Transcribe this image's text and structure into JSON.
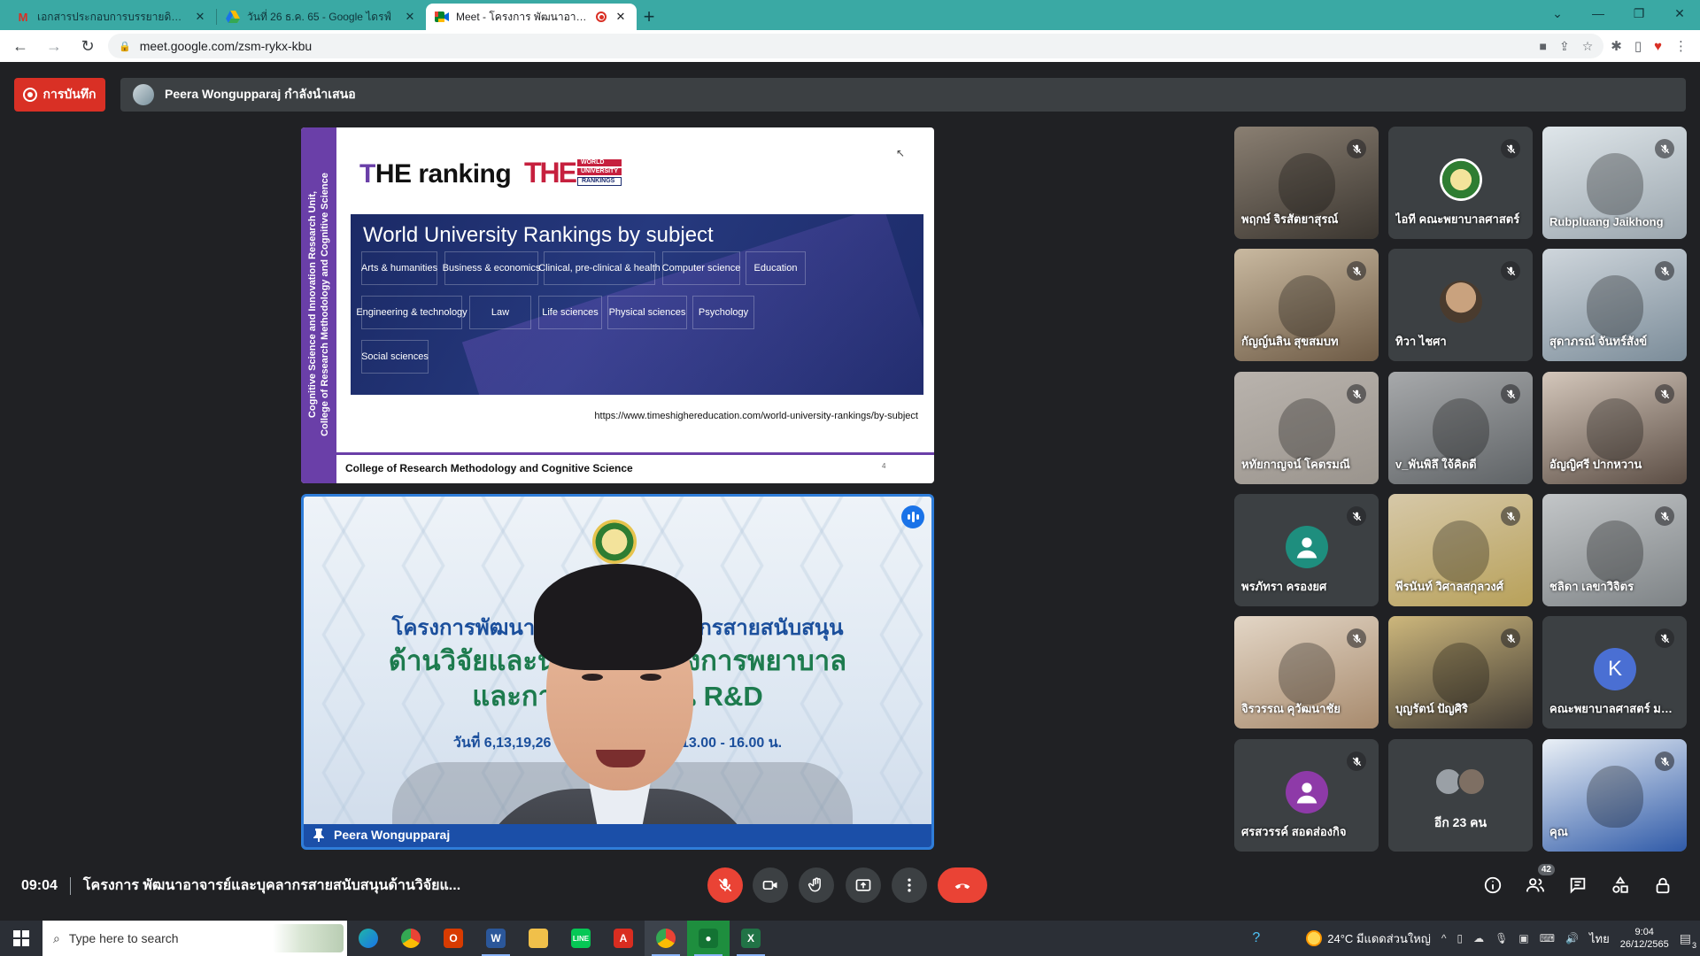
{
  "browser": {
    "tabs": [
      {
        "title": "เอกสารประกอบการบรรยายดิจิทัลพิมพ์นำเสนอ",
        "favicon": "gmail-icon",
        "active": false
      },
      {
        "title": "วันที่ 26 ธ.ค. 65 - Google ไดรฟ์",
        "favicon": "google-drive-icon",
        "active": false
      },
      {
        "title": "Meet - โครงการ พัฒนาอาจารย์และบุคลากร",
        "favicon": "google-meet-icon",
        "active": true
      }
    ],
    "new_tab": "+",
    "url": "meet.google.com/zsm-rykx-kbu"
  },
  "meet": {
    "recording_label": "การบันทึก",
    "presenting_text": "Peera Wongupparaj กำลังนำเสนอ",
    "slide": {
      "side_text_line1": "Cognitive Science and Innovation Research Unit,",
      "side_text_line2": "College of Research Methodology and Cognitive Science",
      "title_first": "T",
      "title_rest": "HE ranking",
      "logo_mark": "THE",
      "logo_line1": "WORLD",
      "logo_line2": "UNIVERSITY",
      "logo_line3": "RANKINGS",
      "panel_title": "World University Rankings by subject",
      "subjects": [
        "Arts & humanities",
        "Business & economics",
        "Clinical, pre-clinical & health",
        "Computer science",
        "Education",
        "Engineering & technology",
        "Law",
        "Life sciences",
        "Physical sciences",
        "Psychology",
        "Social sciences"
      ],
      "url": "https://www.timeshighereducation.com/world-university-rankings/by-subject",
      "footer": "College of Research Methodology and Cognitive Science",
      "page_number": "4"
    },
    "presenter": {
      "name": "Peera Wongupparaj",
      "banner_line1": "โครงการพัฒนาอาจารย์และบุคลากรสายสนับสนุน",
      "banner_line2": "ด้านวิจัยและนวัตกรรมทางการพยาบาล",
      "banner_line3": "และการดำเนินงาน R&D",
      "banner_line4": "แบบ",
      "banner_line5": "วันที่ 6,13,19,26 ธันวาคม 2565 เวลา 13.00 - 16.00 น.",
      "banner_line6": "CNEU"
    },
    "participants": [
      {
        "name": "พฤกษ์ จิรสัตยาสุรณ์",
        "kind": "photo",
        "colors": [
          "#8a7f72",
          "#3b3630"
        ]
      },
      {
        "name": "ไอที คณะพยาบาลศาสตร์",
        "kind": "logo",
        "colors": [
          "#3c4043",
          "#2e7d32"
        ]
      },
      {
        "name": "Rubpluang Jaikhong",
        "kind": "photo",
        "colors": [
          "#dfe6ea",
          "#9aa5ad"
        ]
      },
      {
        "name": "กัญญ์นลิน สุขสมบท",
        "kind": "photo",
        "colors": [
          "#c9b9a0",
          "#6d5a45"
        ]
      },
      {
        "name": "ทิวา ไชศา",
        "kind": "photo-avatar",
        "colors": [
          "#3c4043",
          "#c9a27e"
        ]
      },
      {
        "name": "สุดาภรณ์ จันทร์สังข์",
        "kind": "photo",
        "colors": [
          "#cfd6dc",
          "#7b8c99"
        ]
      },
      {
        "name": "หทัยกาญจน์ โคตรมณี",
        "kind": "photo",
        "colors": [
          "#b9b3ad",
          "#9a948d"
        ]
      },
      {
        "name": "v_พันพิลึ ใจ้คิดดี",
        "kind": "photo",
        "colors": [
          "#a7a9ab",
          "#5f6366"
        ]
      },
      {
        "name": "อัญญิศรี ปากหวาน",
        "kind": "photo",
        "colors": [
          "#d4c7bb",
          "#5b4d44"
        ]
      },
      {
        "name": "พรภัทรา ครองยศ",
        "kind": "avatar",
        "initial": "",
        "colors": [
          "#3c4043",
          "#1e8e7e"
        ]
      },
      {
        "name": "พีรนันท์ วิศาลสกุลวงศ์",
        "kind": "photo",
        "colors": [
          "#d6c8a8",
          "#b8a15a"
        ]
      },
      {
        "name": "ชลิดา เลขาวิจิตร",
        "kind": "photo",
        "colors": [
          "#c3c6c8",
          "#7e8386"
        ]
      },
      {
        "name": "จิรวรรณ คุวัฒนาชัย",
        "kind": "photo",
        "colors": [
          "#e3d6c6",
          "#a78a6d"
        ]
      },
      {
        "name": "บุญรัตน์ ปัญศิริ",
        "kind": "photo",
        "colors": [
          "#cdb77c",
          "#403a33"
        ]
      },
      {
        "name": "คณะพยาบาลศาสตร์ มหาวิทยาลัย",
        "kind": "avatar",
        "initial": "K",
        "colors": [
          "#3c4043",
          "#4a6fd3"
        ]
      },
      {
        "name": "ศรสวรรค์ สอดส่องกิจ",
        "kind": "avatar",
        "initial": "",
        "colors": [
          "#3c4043",
          "#8e3aa8"
        ]
      },
      {
        "name": "อีก 23 คน",
        "kind": "more",
        "colors": [
          "#3c4043",
          "#9aa0a6"
        ]
      },
      {
        "name": "คุณ",
        "kind": "self",
        "colors": [
          "#eaf0f6",
          "#2f5aa8"
        ]
      }
    ],
    "bottom": {
      "time": "09:04",
      "meeting_title": "โครงการ พัฒนาอาจารย์และบุคลากรสายสนับสนุนด้านวิจัยแ...",
      "participant_count": "42"
    }
  },
  "taskbar": {
    "search_placeholder": "Type here to search",
    "weather": "24°C มีแดดส่วนใหญ่",
    "language": "ไทย",
    "time": "9:04",
    "date": "26/12/2565",
    "notifications": "3"
  }
}
